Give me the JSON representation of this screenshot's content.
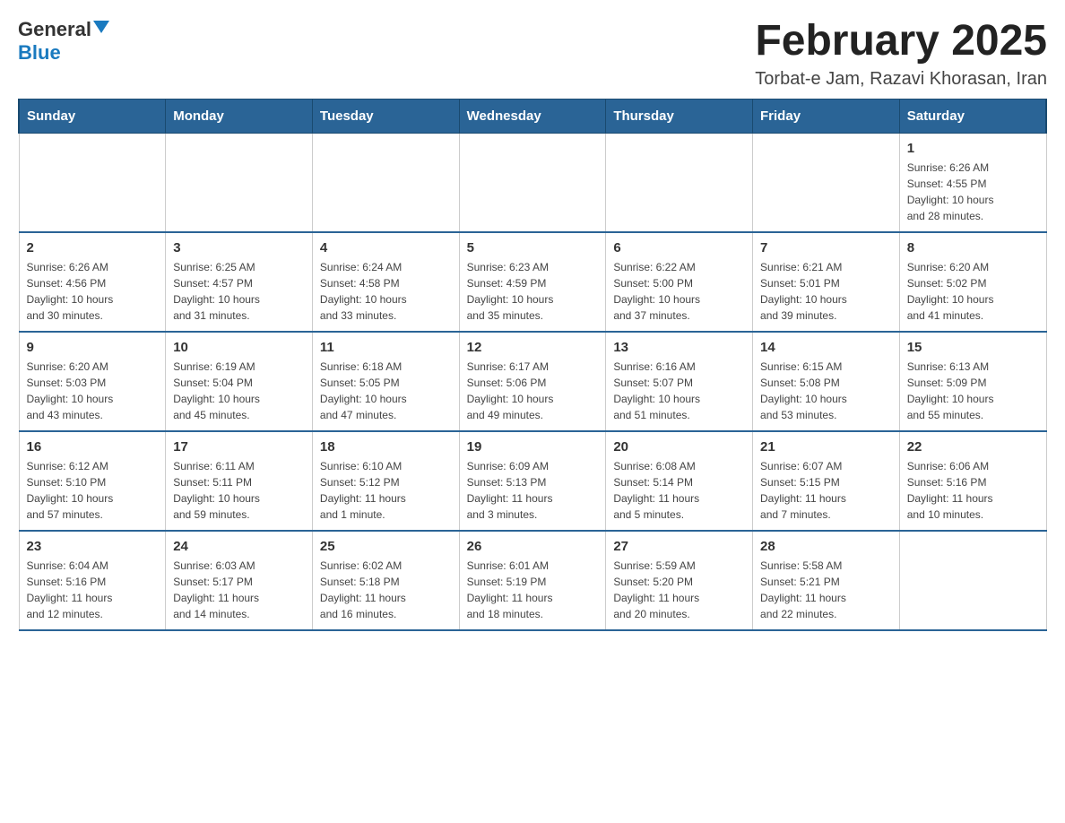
{
  "header": {
    "logo_general": "General",
    "logo_blue": "Blue",
    "month_year": "February 2025",
    "location": "Torbat-e Jam, Razavi Khorasan, Iran"
  },
  "weekdays": [
    "Sunday",
    "Monday",
    "Tuesday",
    "Wednesday",
    "Thursday",
    "Friday",
    "Saturday"
  ],
  "weeks": [
    [
      {
        "day": "",
        "info": ""
      },
      {
        "day": "",
        "info": ""
      },
      {
        "day": "",
        "info": ""
      },
      {
        "day": "",
        "info": ""
      },
      {
        "day": "",
        "info": ""
      },
      {
        "day": "",
        "info": ""
      },
      {
        "day": "1",
        "info": "Sunrise: 6:26 AM\nSunset: 4:55 PM\nDaylight: 10 hours\nand 28 minutes."
      }
    ],
    [
      {
        "day": "2",
        "info": "Sunrise: 6:26 AM\nSunset: 4:56 PM\nDaylight: 10 hours\nand 30 minutes."
      },
      {
        "day": "3",
        "info": "Sunrise: 6:25 AM\nSunset: 4:57 PM\nDaylight: 10 hours\nand 31 minutes."
      },
      {
        "day": "4",
        "info": "Sunrise: 6:24 AM\nSunset: 4:58 PM\nDaylight: 10 hours\nand 33 minutes."
      },
      {
        "day": "5",
        "info": "Sunrise: 6:23 AM\nSunset: 4:59 PM\nDaylight: 10 hours\nand 35 minutes."
      },
      {
        "day": "6",
        "info": "Sunrise: 6:22 AM\nSunset: 5:00 PM\nDaylight: 10 hours\nand 37 minutes."
      },
      {
        "day": "7",
        "info": "Sunrise: 6:21 AM\nSunset: 5:01 PM\nDaylight: 10 hours\nand 39 minutes."
      },
      {
        "day": "8",
        "info": "Sunrise: 6:20 AM\nSunset: 5:02 PM\nDaylight: 10 hours\nand 41 minutes."
      }
    ],
    [
      {
        "day": "9",
        "info": "Sunrise: 6:20 AM\nSunset: 5:03 PM\nDaylight: 10 hours\nand 43 minutes."
      },
      {
        "day": "10",
        "info": "Sunrise: 6:19 AM\nSunset: 5:04 PM\nDaylight: 10 hours\nand 45 minutes."
      },
      {
        "day": "11",
        "info": "Sunrise: 6:18 AM\nSunset: 5:05 PM\nDaylight: 10 hours\nand 47 minutes."
      },
      {
        "day": "12",
        "info": "Sunrise: 6:17 AM\nSunset: 5:06 PM\nDaylight: 10 hours\nand 49 minutes."
      },
      {
        "day": "13",
        "info": "Sunrise: 6:16 AM\nSunset: 5:07 PM\nDaylight: 10 hours\nand 51 minutes."
      },
      {
        "day": "14",
        "info": "Sunrise: 6:15 AM\nSunset: 5:08 PM\nDaylight: 10 hours\nand 53 minutes."
      },
      {
        "day": "15",
        "info": "Sunrise: 6:13 AM\nSunset: 5:09 PM\nDaylight: 10 hours\nand 55 minutes."
      }
    ],
    [
      {
        "day": "16",
        "info": "Sunrise: 6:12 AM\nSunset: 5:10 PM\nDaylight: 10 hours\nand 57 minutes."
      },
      {
        "day": "17",
        "info": "Sunrise: 6:11 AM\nSunset: 5:11 PM\nDaylight: 10 hours\nand 59 minutes."
      },
      {
        "day": "18",
        "info": "Sunrise: 6:10 AM\nSunset: 5:12 PM\nDaylight: 11 hours\nand 1 minute."
      },
      {
        "day": "19",
        "info": "Sunrise: 6:09 AM\nSunset: 5:13 PM\nDaylight: 11 hours\nand 3 minutes."
      },
      {
        "day": "20",
        "info": "Sunrise: 6:08 AM\nSunset: 5:14 PM\nDaylight: 11 hours\nand 5 minutes."
      },
      {
        "day": "21",
        "info": "Sunrise: 6:07 AM\nSunset: 5:15 PM\nDaylight: 11 hours\nand 7 minutes."
      },
      {
        "day": "22",
        "info": "Sunrise: 6:06 AM\nSunset: 5:16 PM\nDaylight: 11 hours\nand 10 minutes."
      }
    ],
    [
      {
        "day": "23",
        "info": "Sunrise: 6:04 AM\nSunset: 5:16 PM\nDaylight: 11 hours\nand 12 minutes."
      },
      {
        "day": "24",
        "info": "Sunrise: 6:03 AM\nSunset: 5:17 PM\nDaylight: 11 hours\nand 14 minutes."
      },
      {
        "day": "25",
        "info": "Sunrise: 6:02 AM\nSunset: 5:18 PM\nDaylight: 11 hours\nand 16 minutes."
      },
      {
        "day": "26",
        "info": "Sunrise: 6:01 AM\nSunset: 5:19 PM\nDaylight: 11 hours\nand 18 minutes."
      },
      {
        "day": "27",
        "info": "Sunrise: 5:59 AM\nSunset: 5:20 PM\nDaylight: 11 hours\nand 20 minutes."
      },
      {
        "day": "28",
        "info": "Sunrise: 5:58 AM\nSunset: 5:21 PM\nDaylight: 11 hours\nand 22 minutes."
      },
      {
        "day": "",
        "info": ""
      }
    ]
  ]
}
